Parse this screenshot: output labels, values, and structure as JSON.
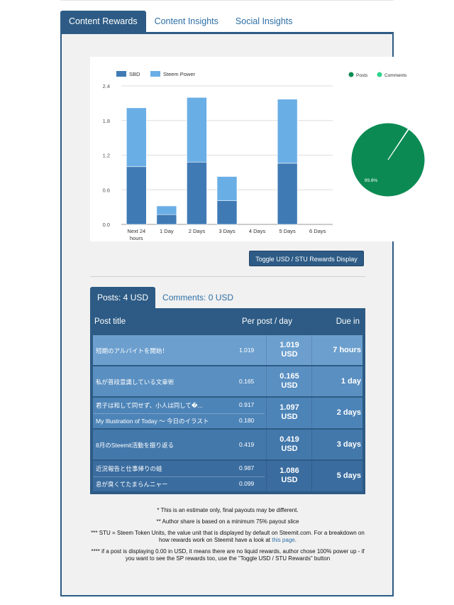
{
  "tabs": [
    {
      "label": "Content Rewards",
      "active": true
    },
    {
      "label": "Content Insights",
      "active": false
    },
    {
      "label": "Social Insights",
      "active": false
    }
  ],
  "chart_data": [
    {
      "type": "bar",
      "stacked": true,
      "categories": [
        "Next 24 hours",
        "1 Day",
        "2 Days",
        "3 Days",
        "4 Days",
        "5 Days",
        "6 Days"
      ],
      "series": [
        {
          "name": "SBD",
          "color": "#3f7ab5",
          "values": [
            1.0,
            0.17,
            1.08,
            0.41,
            0,
            1.06,
            0
          ]
        },
        {
          "name": "Steem Power",
          "color": "#6aaee6",
          "values": [
            1.02,
            0.15,
            1.12,
            0.42,
            0,
            1.11,
            0
          ]
        }
      ],
      "yticks": [
        "0.0",
        "0.6",
        "1.2",
        "1.8",
        "2.4"
      ],
      "ylim": [
        0,
        2.4
      ],
      "grid": true,
      "legend": "top-left"
    },
    {
      "type": "pie",
      "labels": [
        "Posts",
        "Comments"
      ],
      "colors": [
        "#0b8b53",
        "#2fd38e"
      ],
      "values": [
        99.8,
        0.2
      ],
      "slice_labels": [
        "99.8%"
      ],
      "legend": "top-right"
    }
  ],
  "toggle_button": {
    "label": "Toggle USD / STU Rewards Display"
  },
  "subtabs": [
    {
      "label": "Posts: 4 USD",
      "active": true
    },
    {
      "label": "Comments: 0 USD",
      "active": false
    }
  ],
  "table": {
    "headers": {
      "title": "Post title",
      "per": "Per post / day",
      "due": "Due in"
    },
    "groups": [
      {
        "posts": [
          {
            "title": "短期のアルバイトを開始！",
            "value": "1.019"
          }
        ],
        "usd_value": "1.019",
        "usd_unit": "USD",
        "due": "7 hours",
        "bg": "#6c9fce"
      },
      {
        "posts": [
          {
            "title": "私が普段意識している文章術",
            "value": "0.165"
          }
        ],
        "usd_value": "0.165",
        "usd_unit": "USD",
        "due": "1 day",
        "bg": "#5a8fc1"
      },
      {
        "posts": [
          {
            "title": "君子は和して同せず、小人は同して�...",
            "value": "0.917"
          },
          {
            "title": "My Illustration of Today 〜 今日のイラスト",
            "value": "0.180"
          }
        ],
        "usd_value": "1.097",
        "usd_unit": "USD",
        "due": "2 days",
        "bg": "#4d84b8"
      },
      {
        "posts": [
          {
            "title": "8月のSteemit活動を振り返る",
            "value": "0.419"
          }
        ],
        "usd_value": "0.419",
        "usd_unit": "USD",
        "due": "3 days",
        "bg": "#4378ab"
      },
      {
        "posts": [
          {
            "title": "近況報告と仕事帰りの蛙",
            "value": "0.987"
          },
          {
            "title": "息が臭くてたまらんニャー",
            "value": "0.099"
          }
        ],
        "usd_value": "1.086",
        "usd_unit": "USD",
        "due": "5 days",
        "bg": "#3a6c9f"
      }
    ]
  },
  "notes": {
    "n1": "* This is an estimate only, final payouts may be different.",
    "n2": "** Author share is based on a minimum 75% payout slice",
    "n3_text": "*** STU = Steem Token Units, the value unit that is displayed by default on Steemit.com. For a breakdown on how rewards work on Steemit have a look at",
    "n3_link": "this page",
    "n3_end": ".",
    "n4": "**** if a post is displaying 0.00 in USD, it means there are no liquid rewards, author chose 100% power up - if you want to see the SP rewards too, use the \"Toggle USD / STU Rewards\" button"
  }
}
